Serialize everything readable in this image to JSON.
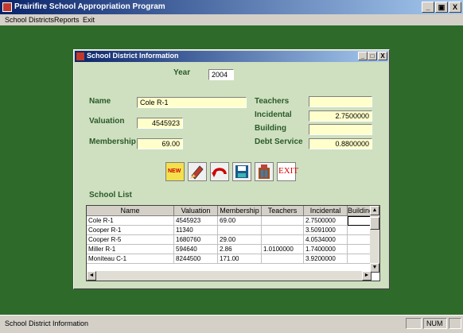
{
  "app": {
    "title": "Prairifire School Appropriation Program",
    "controls": {
      "minimize": "_",
      "restore": "7",
      "close": "X"
    }
  },
  "menu": [
    "School Districts",
    "Reports",
    "Exit"
  ],
  "window": {
    "title": "School District Information",
    "controls": {
      "minimize": "_",
      "restore": "□",
      "close": "X"
    }
  },
  "form": {
    "year_label": "Year",
    "year_value": "2004",
    "name_label": "Name",
    "name_value": "Cole R-1",
    "valuation_label": "Valuation",
    "valuation_value": "4545923",
    "membership_label": "Membership",
    "membership_value": "69.00",
    "teachers_label": "Teachers",
    "teachers_value": "",
    "incidental_label": "Incidental",
    "incidental_value": "2.7500000",
    "building_label": "Building",
    "building_value": "",
    "debt_label": "Debt Service",
    "debt_value": "0.8800000"
  },
  "toolbar": {
    "new_label": "NEW",
    "exit_label": "EXIT",
    "icons": [
      "new-icon",
      "edit-icon",
      "undo-icon",
      "save-icon",
      "delete-icon",
      "exit-icon"
    ]
  },
  "school_list": {
    "label": "School List",
    "columns": [
      "Name",
      "Valuation",
      "Membership",
      "Teachers",
      "Incidental",
      "Building"
    ],
    "rows": [
      [
        "Cole R-1",
        "4545923",
        "69.00",
        "",
        "2.7500000",
        ""
      ],
      [
        "Cooper R-1",
        "11340",
        "",
        "",
        "3.5091000",
        ""
      ],
      [
        "Cooper R-5",
        "1680760",
        "29.00",
        "",
        "4.0534000",
        ""
      ],
      [
        "Miller R-1",
        "594640",
        "2.86",
        "1.0100000",
        "1.7400000",
        ""
      ],
      [
        "Moniteau C-1",
        "8244500",
        "171.00",
        "",
        "3.9200000",
        ""
      ]
    ]
  },
  "status": {
    "text": "School District Information",
    "num": "NUM"
  },
  "colors": {
    "desktop": "#2e6b2a",
    "form_bg": "#cfe0c0",
    "field_bg": "#ffffcc",
    "label": "#2a5a2a",
    "titlebar": "#0a246a"
  }
}
